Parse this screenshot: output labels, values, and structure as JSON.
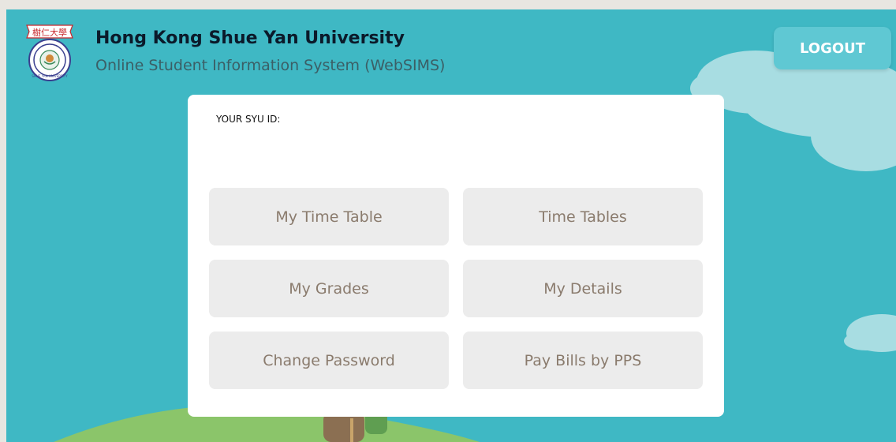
{
  "header": {
    "university_name": "Hong Kong Shue Yan University",
    "system_name": "Online Student Information System (WebSIMS)",
    "logo_chinese": "樹仁大學",
    "logo_english": "SHUE YAN UNIVERSITY",
    "logout_label": "LOGOUT"
  },
  "card": {
    "id_label": "YOUR SYU ID:",
    "buttons": [
      {
        "label": "My Time Table"
      },
      {
        "label": "Time Tables"
      },
      {
        "label": "My Grades"
      },
      {
        "label": "My Details"
      },
      {
        "label": "Change Password"
      },
      {
        "label": "Pay Bills by PPS"
      }
    ]
  },
  "colors": {
    "background": "#3fb8c4",
    "button": "#ececec",
    "button_text": "#8a7b6d",
    "logout": "#5fc8d3",
    "logo_red": "#c8282d"
  }
}
